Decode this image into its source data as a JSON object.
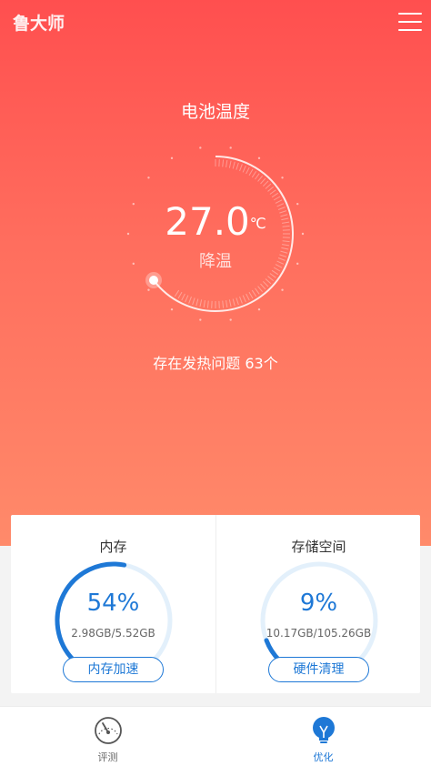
{
  "app": {
    "logo_text": "鲁大师"
  },
  "header": {
    "menu_icon": "hamburger-menu-icon"
  },
  "battery": {
    "title": "电池温度",
    "temperature": "27.0",
    "unit": "℃",
    "action_label": "降温",
    "issues_text": "存在发热问题 63个"
  },
  "memory": {
    "title": "内存",
    "percent_text": "54%",
    "percent": 54,
    "usage_text": "2.98GB/5.52GB",
    "button_label": "内存加速"
  },
  "storage": {
    "title": "存储空间",
    "percent_text": "9%",
    "percent": 9,
    "usage_text": "10.17GB/105.26GB",
    "button_label": "硬件清理"
  },
  "tabs": [
    {
      "label": "评测",
      "icon": "speedometer-icon",
      "active": false
    },
    {
      "label": "优化",
      "icon": "lightbulb-icon",
      "active": true
    }
  ],
  "colors": {
    "accent": "#1e78d6",
    "hero_top": "#ff4f4f",
    "hero_bottom": "#ff8a6a",
    "ring_track": "#e3f0fb"
  }
}
